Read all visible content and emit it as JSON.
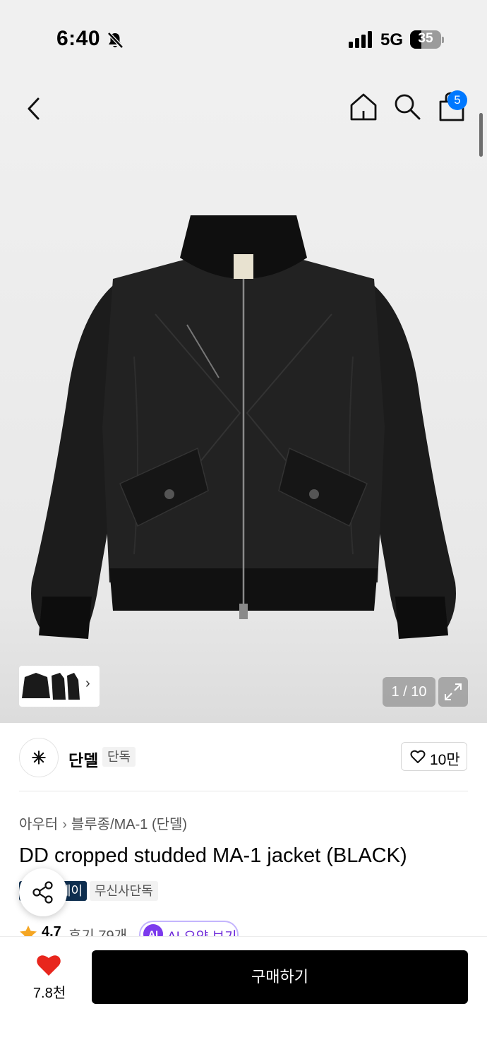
{
  "status_bar": {
    "time": "6:40",
    "network": "5G",
    "battery": "35"
  },
  "header": {
    "cart_count": "5"
  },
  "gallery": {
    "counter": "1 / 10"
  },
  "brand": {
    "name": "단델",
    "tag": "단독",
    "likes": "10만"
  },
  "product": {
    "breadcrumb": [
      "아우터",
      "블루종/MA-1 (단델)"
    ],
    "title": "DD cropped studded MA-1 jacket (BLACK)",
    "pay_tag": "페이",
    "exclusive_tag": "무신사단독",
    "rating": "4.7",
    "reviews": "후기 79개",
    "ai_summary": "AI 요약 보기",
    "ai_badge": "AI"
  },
  "bottom_bar": {
    "wish_count": "7.8천",
    "buy_label": "구매하기"
  },
  "colors": {
    "accent_blue": "#0078ff",
    "heart_red": "#e8261d",
    "ai_purple": "#7c3aed",
    "star": "#f5a623"
  }
}
